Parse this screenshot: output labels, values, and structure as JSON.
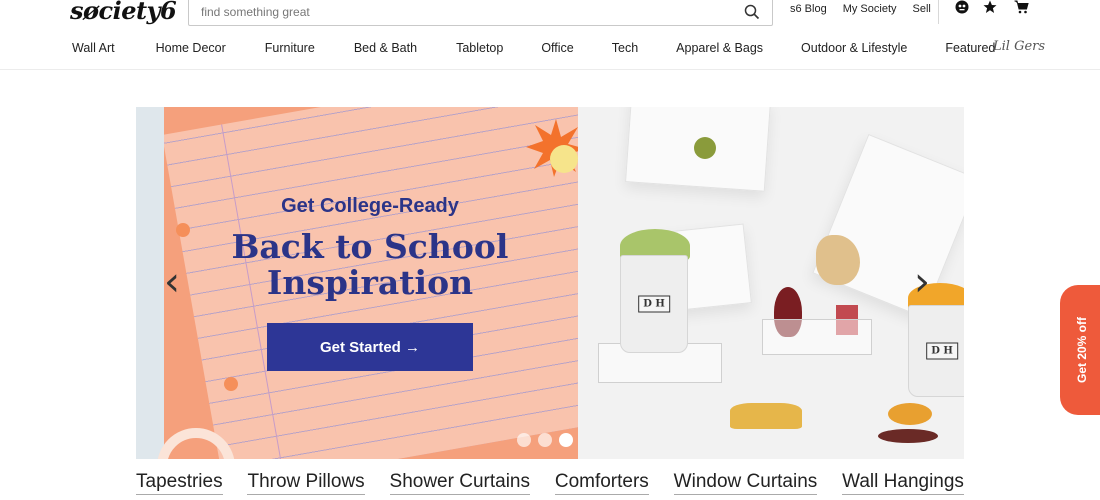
{
  "header": {
    "logo": "søciety6",
    "search": {
      "placeholder": "find something great"
    },
    "links": [
      "s6 Blog",
      "My Society",
      "Sell"
    ],
    "icons": [
      "account-icon",
      "star-icon",
      "cart-icon"
    ]
  },
  "nav": {
    "items": [
      "Wall Art",
      "Home Decor",
      "Furniture",
      "Bed & Bath",
      "Tabletop",
      "Office",
      "Tech",
      "Apparel & Bags",
      "Outdoor & Lifestyle",
      "Featured"
    ],
    "kids": "Lil Gers"
  },
  "hero": {
    "subtitle": "Get College-Ready",
    "title_line1": "Back to School",
    "title_line2": "Inspiration",
    "cta": "Get Started →",
    "cup_label": "D H",
    "slides": 3,
    "active_slide": 3,
    "colors": {
      "accent": "#2d3696",
      "peach": "#f9c3ad",
      "orange": "#f5a07c"
    }
  },
  "promo": {
    "label": "Get 20% off"
  },
  "categories": [
    "Tapestries",
    "Throw Pillows",
    "Shower Curtains",
    "Comforters",
    "Window Curtains",
    "Wall Hangings"
  ]
}
